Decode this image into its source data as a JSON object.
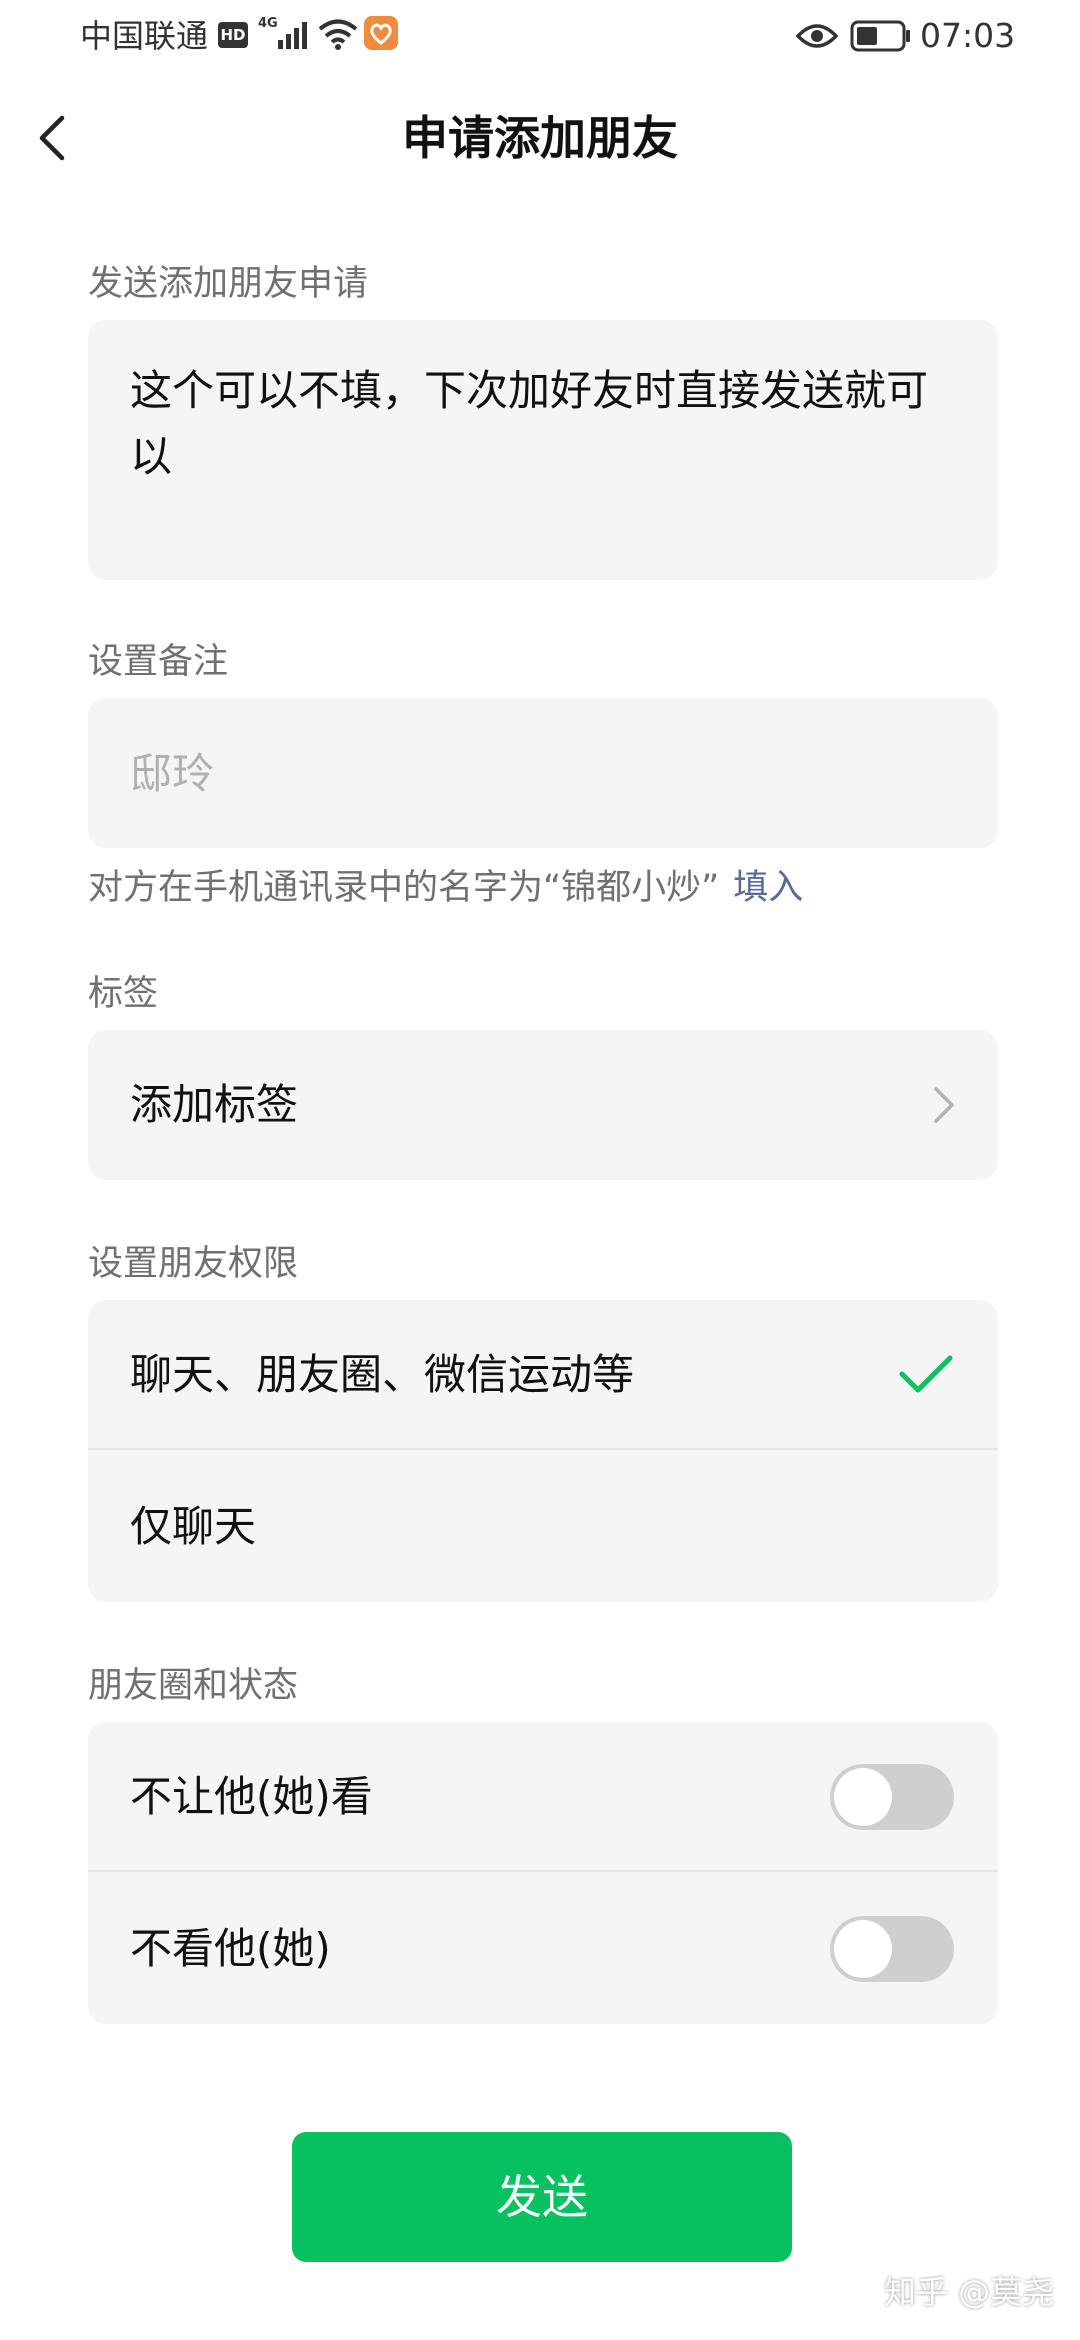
{
  "status_bar": {
    "carrier": "中国联通",
    "hd": "HD",
    "network": "4G",
    "time": "07:03"
  },
  "header": {
    "title": "申请添加朋友",
    "back_icon": "chevron-left-icon"
  },
  "greeting": {
    "label": "发送添加朋友申请",
    "value": "这个可以不填，下次加好友时直接发送就可以"
  },
  "remark": {
    "label": "设置备注",
    "placeholder": "邸玲",
    "hint": "对方在手机通讯录中的名字为“锦都小炒”",
    "fill_link": "填入"
  },
  "tags": {
    "label": "标签",
    "add_label": "添加标签"
  },
  "permissions": {
    "label": "设置朋友权限",
    "options": [
      {
        "label": "聊天、朋友圈、微信运动等",
        "selected": true
      },
      {
        "label": "仅聊天",
        "selected": false
      }
    ]
  },
  "moments": {
    "label": "朋友圈和状态",
    "options": [
      {
        "label": "不让他(她)看",
        "enabled": false
      },
      {
        "label": "不看他(她)",
        "enabled": false
      }
    ]
  },
  "send_button": "发送",
  "watermark": "知乎 @莫尧",
  "colors": {
    "accent": "#07c160",
    "link": "#576b95",
    "card_bg": "#f5f5f5",
    "toggle_off": "#cfcfcf"
  }
}
